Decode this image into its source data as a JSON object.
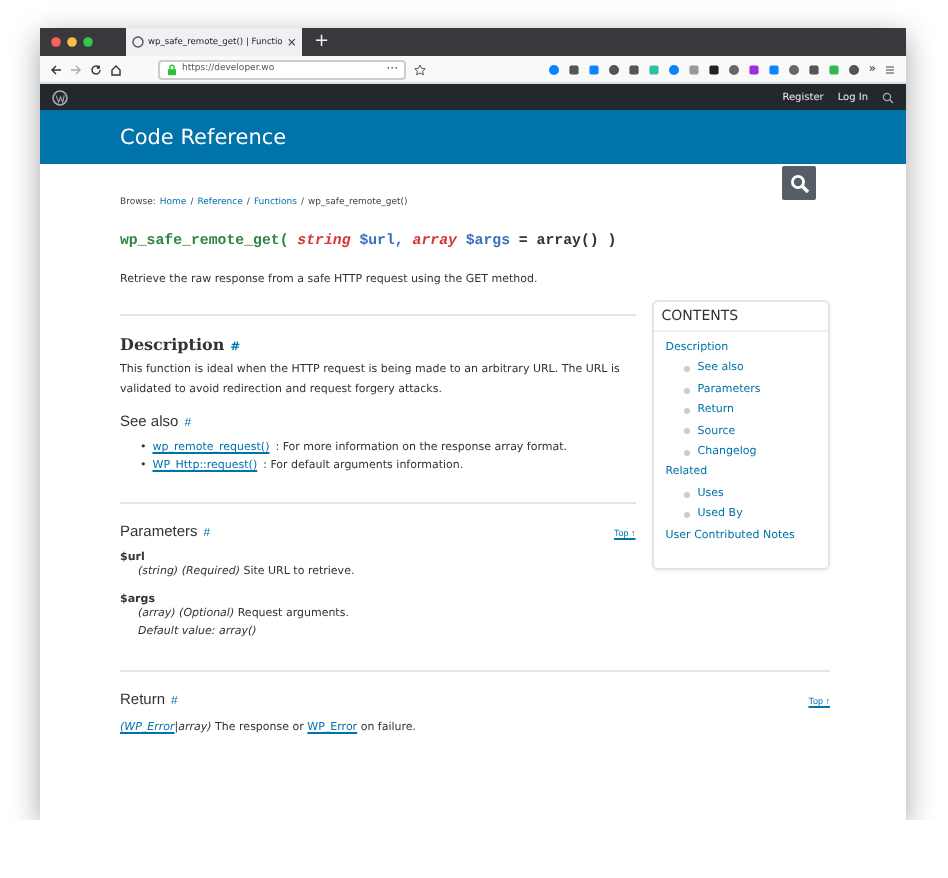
{
  "window": {
    "tab_title": "wp_safe_remote_get() | Functio",
    "new_tab": "+",
    "close": "×"
  },
  "toolbar": {
    "url": "https://developer.wo",
    "more": "···",
    "overflow": "»"
  },
  "admin_bar": {
    "links": [
      "Register",
      "Log In"
    ]
  },
  "header": {
    "title": "Code Reference"
  },
  "breadcrumb": {
    "label": "Browse:",
    "separator": "/",
    "items": [
      {
        "text": "Home",
        "link": true
      },
      {
        "text": "Reference",
        "link": true
      },
      {
        "text": "Functions",
        "link": true
      },
      {
        "text": "wp_safe_remote_get()",
        "link": false
      }
    ]
  },
  "signature": [
    {
      "kind": "name",
      "text": "wp_safe_remote_get("
    },
    {
      "kind": "type",
      "text": "string"
    },
    {
      "kind": "var",
      "text": "$url,"
    },
    {
      "kind": "type",
      "text": "array"
    },
    {
      "kind": "var",
      "text": "$args"
    },
    {
      "kind": "plain",
      "text": "= array() )"
    }
  ],
  "summary": "Retrieve the raw response from a safe HTTP request using the GET method.",
  "description": {
    "heading": "Description",
    "anchor": "#",
    "text": "This function is ideal when the HTTP request is being made to an arbitrary URL. The URL is validated to avoid redirection and request forgery attacks."
  },
  "see_also": {
    "heading": "See also",
    "anchor": "#",
    "marker": "•",
    "items": [
      {
        "link": "wp_remote_request()",
        "text": ": For more information on the response array format."
      },
      {
        "link": "WP_Http::request()",
        "text": ": For default arguments information."
      }
    ]
  },
  "parameters": {
    "heading": "Parameters",
    "anchor": "#",
    "top": "Top ↑",
    "items": [
      {
        "name": "$url",
        "lines": [
          "*(string) (Required)* Site URL to retrieve."
        ]
      },
      {
        "name": "$args",
        "lines": [
          "*(array) (Optional)* Request arguments.",
          "*Default value: array()*"
        ]
      }
    ]
  },
  "return": {
    "heading": "Return",
    "anchor": "#",
    "top": "Top ↑",
    "parts": [
      {
        "text": "(WP_Error",
        "kind": "italic_link"
      },
      {
        "text": "|array)",
        "kind": "italic"
      },
      {
        "text": " The response or",
        "kind": "text"
      },
      {
        "text": "WP_Error",
        "kind": "link"
      },
      {
        "text": "on failure.",
        "kind": "text"
      }
    ]
  },
  "contents": {
    "title": "CONTENTS",
    "items": [
      {
        "label": "Description",
        "children": [
          {
            "label": "See also"
          },
          {
            "label": "Parameters"
          },
          {
            "label": "Return"
          },
          {
            "label": "Source"
          },
          {
            "label": "Changelog"
          }
        ]
      },
      {
        "label": "Related",
        "children": [
          {
            "label": "Uses"
          },
          {
            "label": "Used By"
          }
        ]
      },
      {
        "label": "User Contributed Notes"
      }
    ]
  }
}
